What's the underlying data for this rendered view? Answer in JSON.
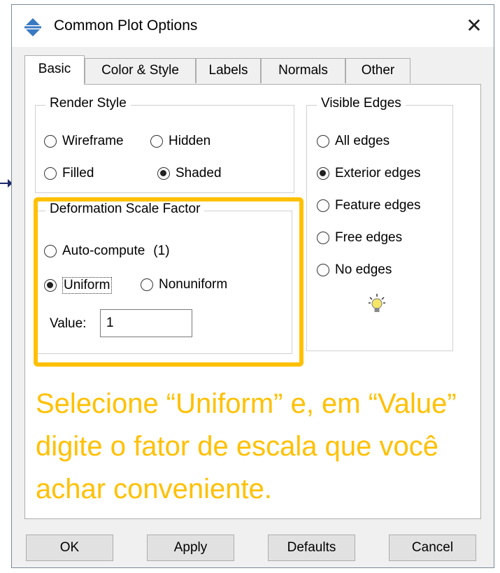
{
  "window": {
    "title": "Common Plot Options",
    "close_symbol": "✕"
  },
  "tabs": [
    "Basic",
    "Color & Style",
    "Labels",
    "Normals",
    "Other"
  ],
  "render_style": {
    "title": "Render Style",
    "options": {
      "wireframe": "Wireframe",
      "hidden": "Hidden",
      "filled": "Filled",
      "shaded": "Shaded"
    },
    "selected": "Shaded"
  },
  "visible_edges": {
    "title": "Visible Edges",
    "options": [
      "All edges",
      "Exterior edges",
      "Feature edges",
      "Free edges",
      "No edges"
    ],
    "selected": "Exterior edges"
  },
  "deformation": {
    "title": "Deformation Scale Factor",
    "auto_label": "Auto-compute",
    "auto_value": "(1)",
    "uniform_label": "Uniform",
    "nonuniform_label": "Nonuniform",
    "selected": "Uniform",
    "value_label": "Value:",
    "value": "1"
  },
  "annotation": {
    "text": "Selecione “Uniform” e, em “Value” digite o fator de escala que você achar conveniente.",
    "color": "#ffc000"
  },
  "buttons": {
    "ok": "OK",
    "apply": "Apply",
    "defaults": "Defaults",
    "cancel": "Cancel"
  },
  "icons": {
    "title_icon": "plot-options-icon",
    "hint_icon": "lightbulb-icon"
  }
}
